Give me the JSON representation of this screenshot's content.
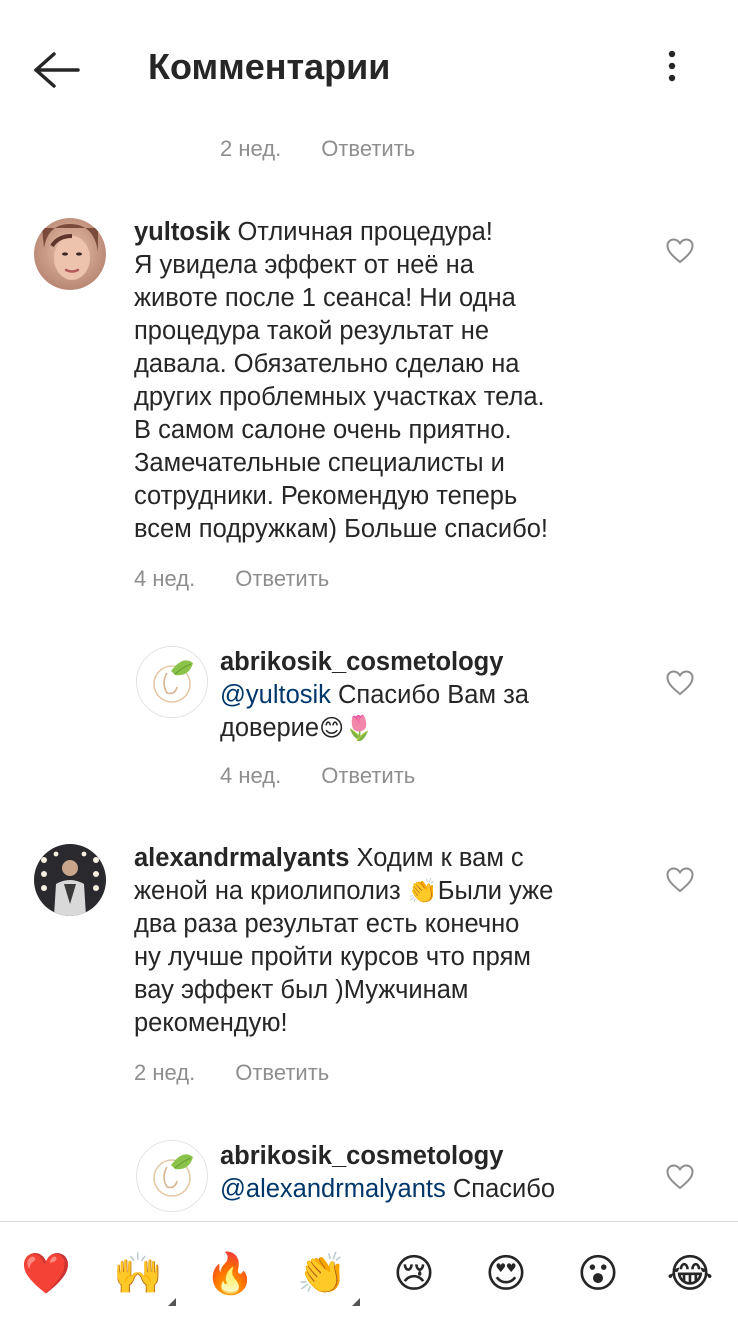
{
  "header": {
    "title": "Комментарии",
    "back_icon": "arrow-left-icon",
    "menu_icon": "more-vertical-icon"
  },
  "top_partial": {
    "time": "2 нед.",
    "reply": "Ответить"
  },
  "comments": [
    {
      "username": "yultosik",
      "lines": [
        "Отличная процедура!",
        "Я увидела эффект от неё на",
        "животе после 1 сеанса! Ни одна",
        "процедура такой результат не",
        "давала. Обязательно сделаю на",
        "других проблемных участках тела.",
        "В самом салоне очень приятно.",
        "Замечательные специалисты и",
        "сотрудники. Рекомендую теперь",
        "всем подружкам) Больше спасибо!"
      ],
      "time": "4 нед.",
      "reply": "Ответить",
      "avatar": "user-photo-avatar"
    },
    {
      "username": "abrikosik_cosmetology",
      "mention": "@yultosik",
      "lines": [
        "Спасибо Вам за",
        "доверие"
      ],
      "emoji": "😊🌷",
      "time": "4 нед.",
      "reply": "Ответить",
      "avatar": "brand-logo-avatar"
    },
    {
      "username": "alexandrmalyants",
      "lines": [
        "Ходим к вам с",
        "женой на криолиполиз",
        "Были уже",
        "два раза результат есть конечно",
        "ну лучше пройти курсов что прям",
        "вау эффект был )Мужчинам",
        "рекомендую!"
      ],
      "emoji": "👏",
      "time": "2 нед.",
      "reply": "Ответить",
      "avatar": "user-photo-avatar"
    },
    {
      "username": "abrikosik_cosmetology",
      "mention": "@alexandrmalyants",
      "lines": [
        "Спасибо"
      ],
      "avatar": "brand-logo-avatar"
    }
  ],
  "quick_reactions": [
    {
      "glyph": "❤️",
      "name": "red-heart-emoji",
      "tones": false
    },
    {
      "glyph": "🙌",
      "name": "raising-hands-emoji",
      "tones": true
    },
    {
      "glyph": "🔥",
      "name": "fire-emoji",
      "tones": false
    },
    {
      "glyph": "👏",
      "name": "clapping-hands-emoji",
      "tones": true
    },
    {
      "glyph": "😢",
      "name": "crying-face-emoji",
      "tones": false
    },
    {
      "glyph": "😍",
      "name": "heart-eyes-emoji",
      "tones": false
    },
    {
      "glyph": "😮",
      "name": "surprised-face-emoji",
      "tones": false
    },
    {
      "glyph": "😂",
      "name": "tears-of-joy-emoji",
      "tones": false
    }
  ],
  "colors": {
    "text": "#262626",
    "secondary": "#8e8e8e",
    "mention": "#00376b",
    "divider": "#dbdbdb",
    "brand_leaf": "#8bc34a"
  }
}
